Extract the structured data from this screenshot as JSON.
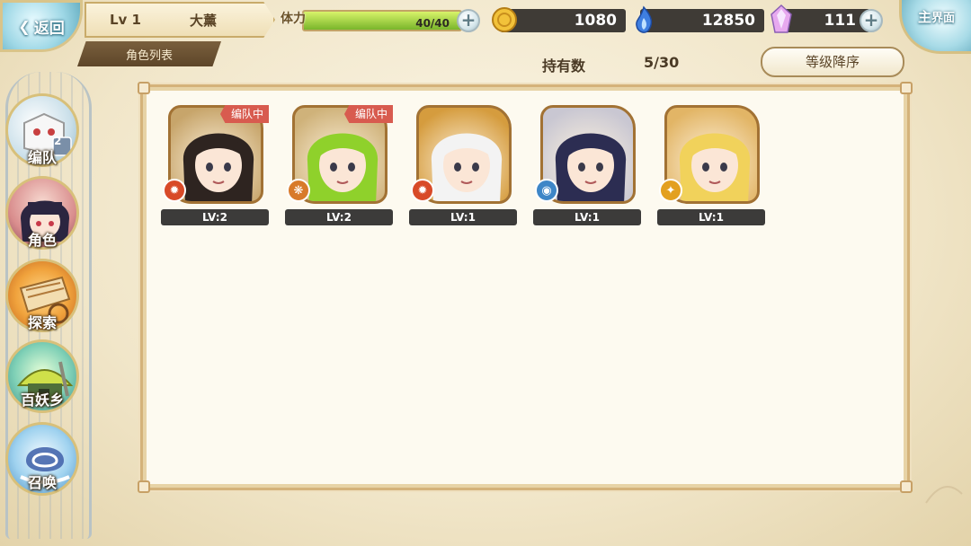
{
  "header": {
    "back_label": "返回",
    "level": "Lv 1",
    "player_name": "大薰",
    "section_tab": "角色列表",
    "stamina_label": "体力",
    "stamina_text": "40/40",
    "stamina_fraction": 1.0,
    "gold": "1080",
    "soul": "12850",
    "crystal": "111",
    "main_menu_label_1": "主",
    "main_menu_label_2": "界面"
  },
  "sidebar": {
    "items": [
      {
        "label": "编队",
        "icon": "team-icon",
        "badge": "2"
      },
      {
        "label": "角色",
        "icon": "character-icon"
      },
      {
        "label": "探索",
        "icon": "explore-icon"
      },
      {
        "label": "百妖乡",
        "icon": "village-icon"
      },
      {
        "label": "召唤",
        "icon": "summon-icon"
      }
    ]
  },
  "roster": {
    "owned_label": "持有数",
    "owned_value": "5/30",
    "sort_label": "等级降序",
    "team_tag": "编队中",
    "characters": [
      {
        "level": "LV:2",
        "in_team": true,
        "element": "fire",
        "element_color": "#d84a28",
        "hair": "#2e2420",
        "bg": "#c7a56b"
      },
      {
        "level": "LV:2",
        "in_team": true,
        "element": "wind",
        "element_color": "#d87a2a",
        "hair": "#8fd12b",
        "bg": "#cfb27a"
      },
      {
        "level": "LV:1",
        "in_team": false,
        "element": "fire",
        "element_color": "#d84a28",
        "hair": "#f3f3f3",
        "bg": "#d59c3e"
      },
      {
        "level": "LV:1",
        "in_team": false,
        "element": "water",
        "element_color": "#3e86c7",
        "hair": "#2c2d52",
        "bg": "#c9c7d2"
      },
      {
        "level": "LV:1",
        "in_team": false,
        "element": "light",
        "element_color": "#e3a020",
        "hair": "#f1d25b",
        "bg": "#e2b566"
      }
    ]
  }
}
